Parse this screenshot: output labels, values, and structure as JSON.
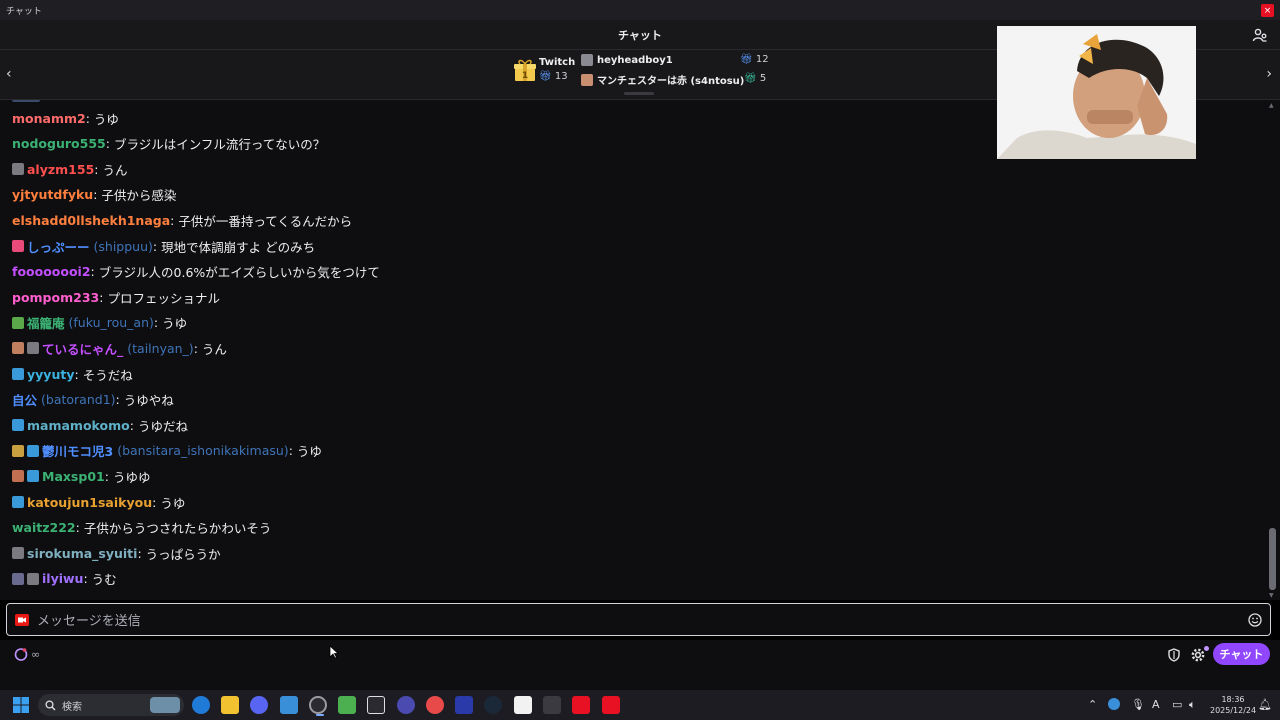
{
  "window": {
    "title": "チャット",
    "close_label": "×"
  },
  "header": {
    "title": "チャット"
  },
  "leaderboard": {
    "prev_label": "‹",
    "next_label": "›",
    "source_label": "Twitch",
    "source_count": "13",
    "entries": [
      {
        "name": "heyheadboy1",
        "count": "12"
      },
      {
        "name": "マンチェスターは赤 (s4ntosu)",
        "count": "5"
      }
    ]
  },
  "messages": [
    {
      "user": "monamm2",
      "login": "",
      "text": "うゆ",
      "color": "#ff6b6b",
      "badges": []
    },
    {
      "user": "nodoguro555",
      "login": "",
      "text": "ブラジルはインフル流行ってないの？",
      "color": "#3bb273",
      "badges": []
    },
    {
      "user": "alyzm155",
      "login": "",
      "text": "うん",
      "color": "#ff4f4f",
      "badges": [
        "#7a7a80"
      ]
    },
    {
      "user": "yjtyutdfyku",
      "login": "",
      "text": "子供から感染",
      "color": "#ff7f3f",
      "badges": []
    },
    {
      "user": "elshadd0llshekh1naga",
      "login": "",
      "text": "子供が一番持ってくるんだから",
      "color": "#ff7f3f",
      "badges": []
    },
    {
      "user": "しっぷーー",
      "login": "(shippuu)",
      "text": "現地で体調崩すよ どのみち",
      "color": "#4f8fff",
      "badges": [
        "#e84a7a"
      ]
    },
    {
      "user": "foooooooi2",
      "login": "",
      "text": "ブラジル人の0.6%がエイズらしいから気をつけて",
      "color": "#c34fff",
      "badges": []
    },
    {
      "user": "pompom233",
      "login": "",
      "text": "プロフェッショナル",
      "color": "#ff5fcf",
      "badges": []
    },
    {
      "user": "福籠庵",
      "login": "(fuku_rou_an)",
      "text": "うゆ",
      "color": "#3bb273",
      "badges": [
        "#5aa84a"
      ]
    },
    {
      "user": "ているにゃん_",
      "login": "(tailnyan_)",
      "text": "うん",
      "color": "#c34fff",
      "badges": [
        "#c08060",
        "#7a7a80"
      ]
    },
    {
      "user": "yyyuty",
      "login": "",
      "text": "そうだね",
      "color": "#3bb2e0",
      "badges": [
        "#3a9ad9"
      ]
    },
    {
      "user": "自公",
      "login": "(batorand1)",
      "text": "うゆやね",
      "color": "#4f8fff",
      "badges": []
    },
    {
      "user": "mamamokomo",
      "login": "",
      "text": "うゆだね",
      "color": "#5fb0c8",
      "badges": [
        "#3a9ad9"
      ]
    },
    {
      "user": "鬱川モコ児3",
      "login": "(bansitara_ishonikakimasu)",
      "text": "うゆ",
      "color": "#4f8fff",
      "badges": [
        "#c8a040",
        "#3a9ad9"
      ]
    },
    {
      "user": "Maxsp01",
      "login": "",
      "text": "うゆゆ",
      "color": "#3bb273",
      "badges": [
        "#c07050",
        "#3a9ad9"
      ]
    },
    {
      "user": "katoujun1saikyou",
      "login": "",
      "text": "うゆ",
      "color": "#e8a030",
      "badges": [
        "#3a9ad9"
      ]
    },
    {
      "user": "waitz222",
      "login": "",
      "text": "子供からうつされたらかわいそう",
      "color": "#3bb273",
      "badges": []
    },
    {
      "user": "sirokuma_syuiti",
      "login": "",
      "text": "うっぱらうか",
      "color": "#7fb0c0",
      "badges": [
        "#7a7a80"
      ]
    },
    {
      "user": "ilyiwu",
      "login": "",
      "text": "うむ",
      "color": "#a070ff",
      "badges": [
        "#6a6a90",
        "#7a7a80"
      ]
    }
  ],
  "input": {
    "placeholder": "メッセージを送信"
  },
  "bottom": {
    "points_label": "∞",
    "send_label": "チャット"
  },
  "taskbar": {
    "search_label": "検索",
    "tray_label": "A",
    "time": "18:36",
    "date": "2025/12/24"
  },
  "colors": {
    "accent": "#9147ff",
    "background": "#0e0e10",
    "panel": "#18181b"
  }
}
